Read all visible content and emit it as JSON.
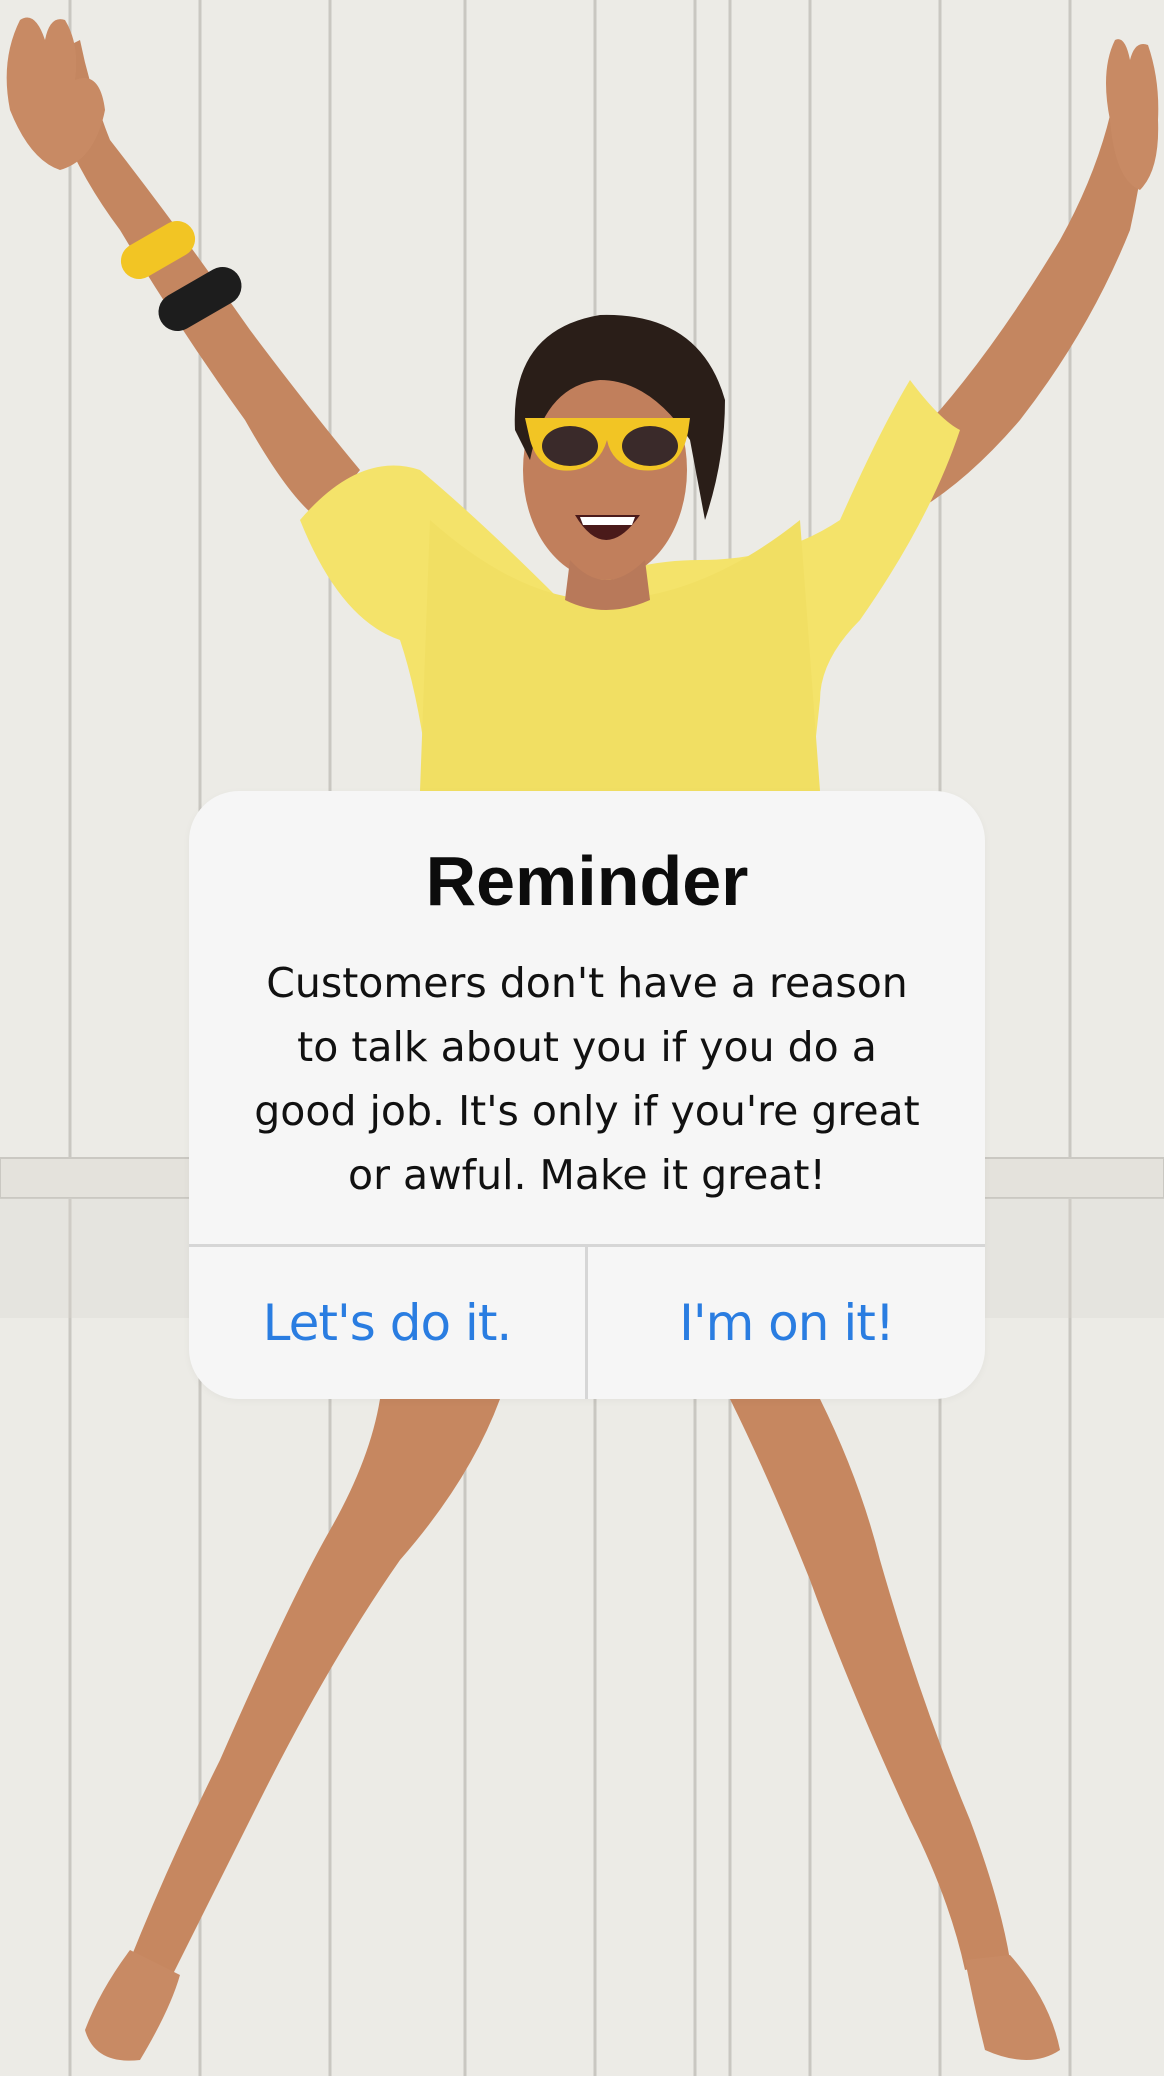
{
  "alert": {
    "title": "Reminder",
    "message": "Customers don't have a reason to talk about you if you do a good job. It's only if you're great or awful. Make it great!",
    "buttons": [
      {
        "label": "Let's do it."
      },
      {
        "label": "I'm on it!"
      }
    ]
  },
  "colors": {
    "button_text": "#2a7de1",
    "alert_background": "#f6f6f6",
    "sweater": "#f4e36a",
    "skin": "#c98a62",
    "sunglasses_frame": "#f2c524"
  }
}
